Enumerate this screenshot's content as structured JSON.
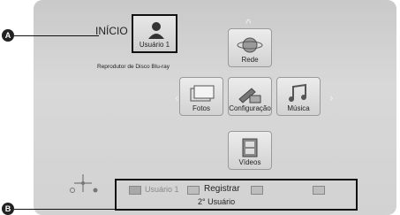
{
  "home": {
    "inicio_label": "INÍCIO",
    "user_label": "Usuário 1",
    "player_label": "Reprodutor de Disco Blu-ray"
  },
  "menu": {
    "rede": "Rede",
    "fotos": "Fotos",
    "configuracao": "Configuração",
    "musica": "Música",
    "videos": "Vídeos"
  },
  "bottom_bar": {
    "user_text": "Usuário 1",
    "registrar": "Registrar",
    "segundo_usuario": "2° Usuário"
  },
  "callouts": {
    "a": "A",
    "b": "B"
  }
}
